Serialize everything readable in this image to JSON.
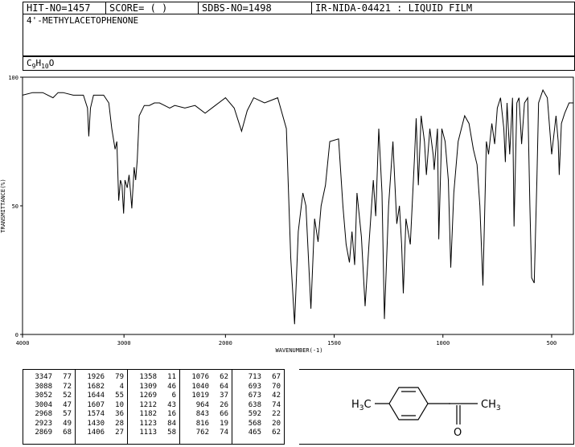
{
  "header": {
    "hit_no": "HIT-NO=1457",
    "score": "SCORE=  (   )",
    "sdbs_no": "SDBS-NO=1498",
    "ir_code": "IR-NIDA-04421 : LIQUID FILM"
  },
  "compound_name": "4'-METHYLACETOPHENONE",
  "formula": {
    "c": "C",
    "c_n": "9",
    "h": "H",
    "h_n": "10",
    "o": "O"
  },
  "chart_data": {
    "type": "line",
    "title": "",
    "xlabel": "WAVENUMBER(-1)",
    "ylabel": "TRANSMITTANCE(%)",
    "xlim": [
      4000,
      400
    ],
    "ylim": [
      0,
      100
    ],
    "x_ticks": [
      4000,
      3000,
      2000,
      1500,
      1000,
      500
    ],
    "y_ticks": [
      0,
      50,
      100
    ],
    "grid": false,
    "series": [
      {
        "x": [
          4000,
          3900,
          3800,
          3700,
          3650,
          3600,
          3500,
          3400,
          3360,
          3347,
          3330,
          3300,
          3200,
          3150,
          3120,
          3088,
          3070,
          3052,
          3035,
          3020,
          3004,
          2990,
          2968,
          2950,
          2935,
          2923,
          2900,
          2885,
          2869,
          2850,
          2800,
          2750,
          2700,
          2650,
          2600,
          2550,
          2500,
          2400,
          2300,
          2200,
          2100,
          2000,
          1960,
          1926,
          1900,
          1870,
          1820,
          1760,
          1720,
          1700,
          1682,
          1665,
          1644,
          1630,
          1607,
          1590,
          1574,
          1560,
          1540,
          1520,
          1480,
          1460,
          1445,
          1430,
          1418,
          1406,
          1395,
          1375,
          1358,
          1340,
          1320,
          1309,
          1295,
          1280,
          1269,
          1250,
          1230,
          1212,
          1200,
          1190,
          1182,
          1170,
          1150,
          1130,
          1123,
          1113,
          1100,
          1085,
          1076,
          1060,
          1045,
          1040,
          1025,
          1019,
          1005,
          990,
          975,
          964,
          950,
          930,
          915,
          900,
          880,
          860,
          843,
          830,
          816,
          800,
          790,
          775,
          762,
          750,
          735,
          720,
          713,
          705,
          693,
          680,
          673,
          660,
          650,
          638,
          625,
          610,
          600,
          592,
          580,
          568,
          560,
          540,
          520,
          500,
          480,
          470,
          465,
          455,
          440,
          420,
          400
        ],
        "y": [
          93,
          94,
          94,
          92,
          94,
          94,
          93,
          93,
          88,
          77,
          88,
          93,
          93,
          90,
          80,
          72,
          75,
          52,
          60,
          58,
          47,
          60,
          57,
          62,
          55,
          49,
          65,
          60,
          68,
          85,
          89,
          89,
          90,
          90,
          89,
          88,
          89,
          88,
          89,
          86,
          89,
          92,
          88,
          79,
          87,
          92,
          90,
          92,
          80,
          30,
          4,
          40,
          55,
          50,
          10,
          45,
          36,
          50,
          58,
          75,
          76,
          50,
          35,
          28,
          40,
          27,
          55,
          38,
          11,
          35,
          60,
          46,
          80,
          55,
          6,
          50,
          75,
          43,
          50,
          35,
          16,
          45,
          35,
          70,
          84,
          58,
          85,
          75,
          62,
          80,
          70,
          64,
          80,
          37,
          80,
          75,
          60,
          26,
          55,
          75,
          80,
          85,
          82,
          72,
          66,
          50,
          19,
          75,
          70,
          82,
          74,
          88,
          92,
          80,
          67,
          90,
          70,
          92,
          42,
          90,
          92,
          74,
          90,
          92,
          50,
          22,
          20,
          60,
          90,
          95,
          92,
          70,
          85,
          75,
          62,
          82,
          86,
          90,
          90
        ]
      }
    ],
    "peak_table": [
      [
        [
          3347,
          77
        ],
        [
          3088,
          72
        ],
        [
          3052,
          52
        ],
        [
          3004,
          47
        ],
        [
          2968,
          57
        ],
        [
          2923,
          49
        ],
        [
          2869,
          68
        ]
      ],
      [
        [
          1926,
          79
        ],
        [
          1682,
          4
        ],
        [
          1644,
          55
        ],
        [
          1607,
          10
        ],
        [
          1574,
          36
        ],
        [
          1430,
          28
        ],
        [
          1406,
          27
        ]
      ],
      [
        [
          1358,
          11
        ],
        [
          1309,
          46
        ],
        [
          1269,
          6
        ],
        [
          1212,
          43
        ],
        [
          1182,
          16
        ],
        [
          1123,
          84
        ],
        [
          1113,
          58
        ]
      ],
      [
        [
          1076,
          62
        ],
        [
          1040,
          64
        ],
        [
          1019,
          37
        ],
        [
          964,
          26
        ],
        [
          843,
          66
        ],
        [
          816,
          19
        ],
        [
          762,
          74
        ]
      ],
      [
        [
          713,
          67
        ],
        [
          693,
          70
        ],
        [
          673,
          42
        ],
        [
          638,
          74
        ],
        [
          592,
          22
        ],
        [
          568,
          20
        ],
        [
          465,
          62
        ]
      ]
    ]
  },
  "structure": {
    "left_group": "H3C",
    "right_group": "CH3",
    "oxygen": "O"
  },
  "colors": {
    "line": "#000000",
    "background": "#ffffff"
  }
}
